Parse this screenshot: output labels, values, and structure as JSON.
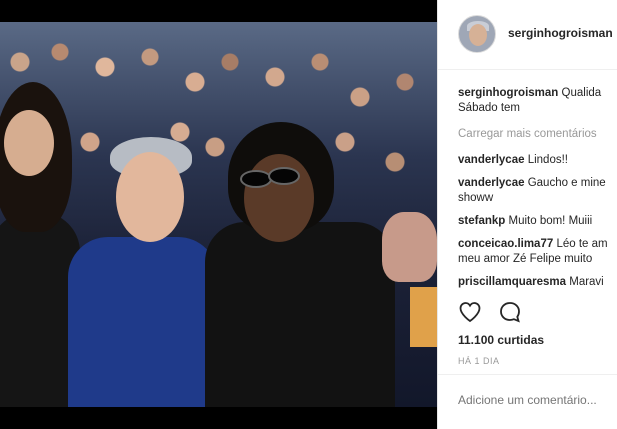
{
  "post": {
    "username": "serginhogroisman",
    "caption": {
      "username": "serginhogroisman",
      "line1": "Qualida",
      "line2": "Sábado tem"
    },
    "load_more": "Carregar mais comentários",
    "comments": [
      {
        "username": "vanderlycae",
        "text": "Lindos!!",
        "continuation": ""
      },
      {
        "username": "vanderlycae",
        "text": "Gaucho e mine",
        "continuation": "showw"
      },
      {
        "username": "stefankp",
        "text": "Muito bom! Muiii",
        "continuation": ""
      },
      {
        "username": "conceicao.lima77",
        "text": "Léo te am",
        "continuation": "meu amor Zé Felipe muito"
      },
      {
        "username": "priscillamquaresma",
        "text": "Maravi",
        "continuation": ""
      }
    ],
    "likes": "11.100 curtidas",
    "time": "HÁ 1 DIA",
    "add_comment_placeholder": "Adicione um comentário..."
  },
  "icons": {
    "like": "heart-icon",
    "comment": "comment-icon"
  },
  "colors": {
    "text": "#262626",
    "muted": "#999999",
    "border": "#efefef"
  }
}
